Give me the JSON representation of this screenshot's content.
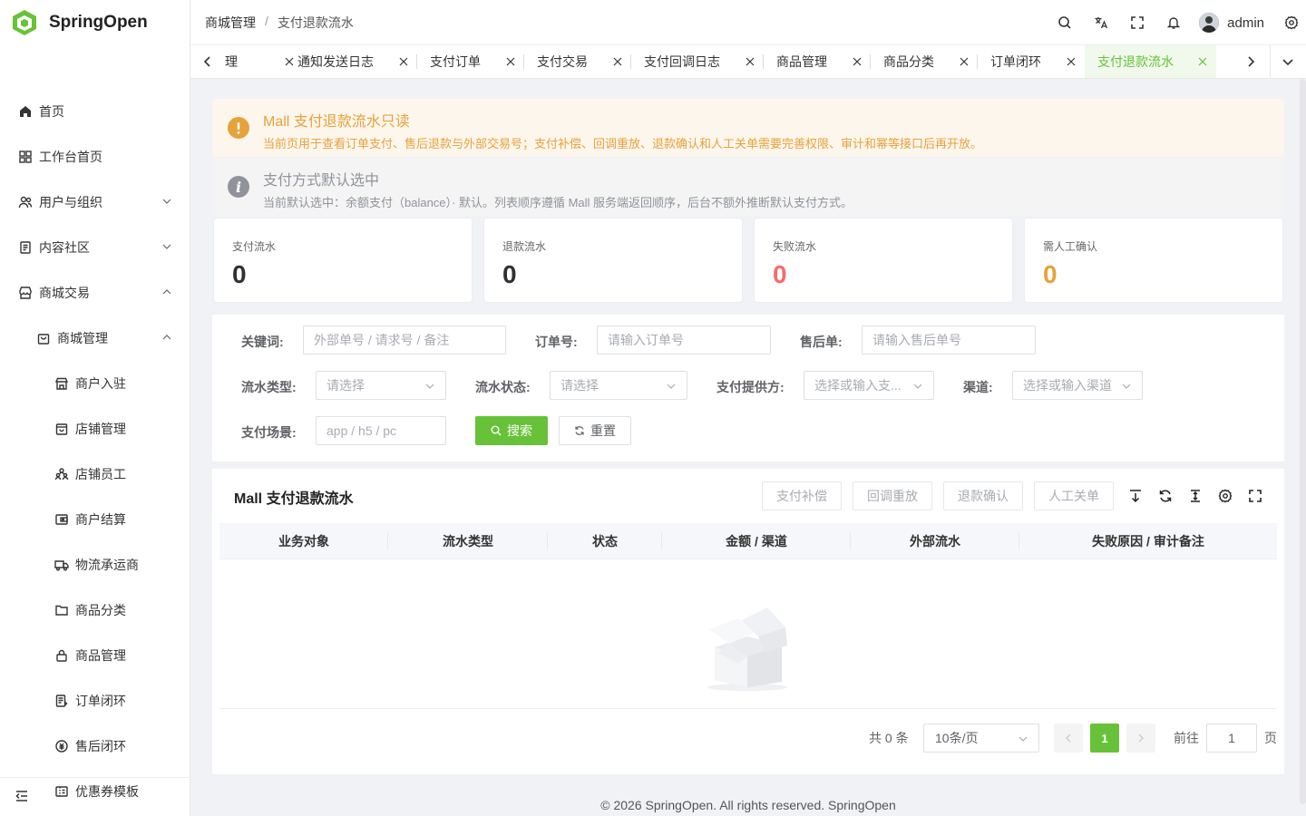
{
  "app": {
    "name": "SpringOpen"
  },
  "sidebar": {
    "items": [
      {
        "label": "首页",
        "icon": "home-icon"
      },
      {
        "label": "工作台首页",
        "icon": "dashboard-icon"
      },
      {
        "label": "用户与组织",
        "icon": "users-icon"
      },
      {
        "label": "内容社区",
        "icon": "document-icon"
      },
      {
        "label": "商城交易",
        "icon": "store-icon"
      },
      {
        "label": "商城管理",
        "icon": "shopping-bag-icon"
      },
      {
        "label": "商户入驻",
        "icon": "shop-icon"
      },
      {
        "label": "店铺管理",
        "icon": "shop-bag-icon"
      },
      {
        "label": "店铺员工",
        "icon": "staff-icon"
      },
      {
        "label": "商户结算",
        "icon": "wallet-icon"
      },
      {
        "label": "物流承运商",
        "icon": "truck-icon"
      },
      {
        "label": "商品分类",
        "icon": "folder-icon"
      },
      {
        "label": "商品管理",
        "icon": "lock-bag-icon"
      },
      {
        "label": "订单闭环",
        "icon": "order-icon"
      },
      {
        "label": "售后闭环",
        "icon": "refund-icon"
      },
      {
        "label": "优惠券模板",
        "icon": "coupon-icon"
      }
    ]
  },
  "header": {
    "breadcrumb": [
      "商城管理",
      "支付退款流水"
    ],
    "user": "admin"
  },
  "tabs": [
    {
      "label": "理"
    },
    {
      "label": "通知发送日志"
    },
    {
      "label": "支付订单"
    },
    {
      "label": "支付交易"
    },
    {
      "label": "支付回调日志"
    },
    {
      "label": "商品管理"
    },
    {
      "label": "商品分类"
    },
    {
      "label": "订单闭环"
    },
    {
      "label": "支付退款流水",
      "active": true
    }
  ],
  "alerts": {
    "readonly": {
      "title": "Mall 支付退款流水只读",
      "desc": "当前页用于查看订单支付、售后退款与外部交易号；支付补偿、回调重放、退款确认和人工关单需要完善权限、审计和幂等接口后再开放。"
    },
    "default_pay": {
      "title": "支付方式默认选中",
      "desc": "当前默认选中：余额支付（balance）· 默认。列表顺序遵循 Mall 服务端返回顺序，后台不额外推断默认支付方式。"
    }
  },
  "stats": [
    {
      "label": "支付流水",
      "value": "0",
      "color": "#303133"
    },
    {
      "label": "退款流水",
      "value": "0",
      "color": "#303133"
    },
    {
      "label": "失败流水",
      "value": "0",
      "color": "#f56c6c"
    },
    {
      "label": "需人工确认",
      "value": "0",
      "color": "#e6a23c"
    }
  ],
  "filters": {
    "keyword": {
      "label": "关键词:",
      "placeholder": "外部单号 / 请求号 / 备注"
    },
    "order_no": {
      "label": "订单号:",
      "placeholder": "请输入订单号"
    },
    "aftersale_no": {
      "label": "售后单:",
      "placeholder": "请输入售后单号"
    },
    "flow_type": {
      "label": "流水类型:",
      "placeholder": "请选择"
    },
    "flow_status": {
      "label": "流水状态:",
      "placeholder": "请选择"
    },
    "provider": {
      "label": "支付提供方:",
      "placeholder": "选择或输入支..."
    },
    "channel": {
      "label": "渠道:",
      "placeholder": "选择或输入渠道"
    },
    "scene": {
      "label": "支付场景:",
      "placeholder": "app / h5 / pc"
    },
    "search_label": "搜索",
    "reset_label": "重置"
  },
  "table": {
    "title": "Mall 支付退款流水",
    "actions": [
      "支付补偿",
      "回调重放",
      "退款确认",
      "人工关单"
    ],
    "columns": [
      "业务对象",
      "流水类型",
      "状态",
      "金额 / 渠道",
      "外部流水",
      "失败原因 / 审计备注"
    ]
  },
  "pagination": {
    "total_text": "共 0 条",
    "page_size": "10条/页",
    "current_page": "1",
    "goto_label": "前往",
    "goto_value": "1",
    "page_suffix": "页"
  },
  "footer": "© 2026 SpringOpen. All rights reserved. SpringOpen",
  "colors": {
    "accent": "#67c23a",
    "warning": "#e6a23c",
    "danger": "#f56c6c"
  }
}
